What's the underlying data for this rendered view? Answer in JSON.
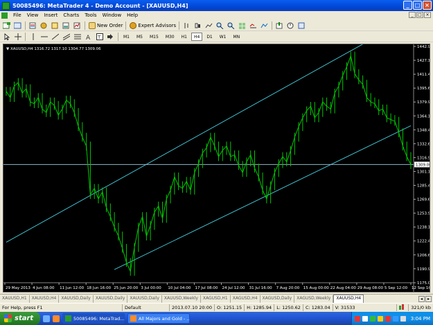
{
  "window": {
    "title": "50085496: MetaTrader 4 - Demo Account - [XAUUSD,H4]",
    "buttons": [
      "_",
      "□",
      "×"
    ]
  },
  "menu": {
    "items": [
      "File",
      "View",
      "Insert",
      "Charts",
      "Tools",
      "Window",
      "Help"
    ],
    "mdi_buttons": [
      "_",
      "□",
      "×"
    ]
  },
  "toolbar": {
    "new_order": "New Order",
    "expert_advisors": "Expert Advisors",
    "timeframes": [
      "M1",
      "M5",
      "M15",
      "M30",
      "H1",
      "H4",
      "D1",
      "W1",
      "MN"
    ],
    "active_timeframe": "H4"
  },
  "chart_data": {
    "type": "line",
    "symbol_header": "XAUUSD,H4  1316.72  1317.10  1304.77  1309.06",
    "current_price_label": "1309.06",
    "ylim": [
      1175.05,
      1442.9
    ],
    "y_ticks": [
      "1442.90",
      "1427.15",
      "1411.40",
      "1395.65",
      "1379.90",
      "1364.15",
      "1348.40",
      "1332.65",
      "1316.90",
      "1301.15",
      "1285.40",
      "1269.65",
      "1253.90",
      "1238.15",
      "1222.40",
      "1206.65",
      "1190.90",
      "1175.05"
    ],
    "x_ticks": [
      "29 May 2013",
      "4 Jun 08:00",
      "11 Jun 12:00",
      "18 Jun 16:00",
      "25 Jun 20:00",
      "3 Jul 00:00",
      "10 Jul 04:00",
      "17 Jul 08:00",
      "24 Jul 12:00",
      "31 Jul 16:00",
      "7 Aug 20:00",
      "15 Aug 00:00",
      "22 Aug 04:00",
      "29 Aug 08:00",
      "5 Sep 12:00",
      "12 Sep 16:00"
    ],
    "price_line": 1309.06,
    "series": [
      {
        "values": [
          1392,
          1385,
          1398,
          1402,
          1390,
          1395,
          1380,
          1378,
          1385,
          1372,
          1368,
          1380,
          1376,
          1365,
          1372,
          1382,
          1378,
          1368,
          1352,
          1340,
          1330,
          1275,
          1282,
          1270,
          1278,
          1260,
          1250,
          1238,
          1228,
          1214,
          1198,
          1188,
          1215,
          1238,
          1250,
          1228,
          1240,
          1255,
          1262,
          1248,
          1270,
          1280,
          1295,
          1285,
          1282,
          1290,
          1280,
          1300,
          1310,
          1322,
          1328,
          1340,
          1330,
          1318,
          1325,
          1330,
          1318,
          1320,
          1308,
          1300,
          1312,
          1320,
          1305,
          1295,
          1280,
          1270,
          1285,
          1300,
          1310,
          1318,
          1312,
          1325,
          1340,
          1352,
          1362,
          1370,
          1375,
          1362,
          1368,
          1380,
          1375,
          1372,
          1390,
          1398,
          1410,
          1420,
          1432,
          1412,
          1405,
          1400,
          1385,
          1380,
          1378,
          1370,
          1372,
          1362,
          1360,
          1358,
          1345,
          1330,
          1318,
          1309
        ]
      }
    ],
    "channel_lines": [
      {
        "x": [
          0,
          90
        ],
        "y": [
          1221,
          1448
        ]
      },
      {
        "x": [
          27,
          101
        ],
        "y": [
          1190,
          1353
        ]
      }
    ]
  },
  "sheet_tabs": [
    "XAUUSD,H1",
    "XAUUSD,H4",
    "XAUUSD,Daily",
    "XAUUSD,Daily",
    "XAUUSD,Daily",
    "XAUUSD,Weekly",
    "XAGUSD,H1",
    "XAGUSD,H4",
    "XAGUSD,Daily",
    "XAGUSD,Weekly",
    "XAUUSD,H4"
  ],
  "active_tab_index": 10,
  "status": {
    "help": "For Help, press F1",
    "profile": "Default",
    "datetime": "2013.07.10 20:00",
    "open": "O: 1251.15",
    "high": "H: 1285.94",
    "low": "L: 1250.62",
    "close": "C: 1283.04",
    "volume": "V: 31533",
    "traffic": "321/0 kb"
  },
  "taskbar": {
    "start": "start",
    "tasks": [
      "50085496: MetaTrad...",
      "All Majors and Gold - ..."
    ],
    "clock": "3:04 PM"
  },
  "colors": {
    "chart_bg": "#000000",
    "candle": "#00c800",
    "channel": "#40c0d0",
    "price_line": "#8fb8c8",
    "axis_text": "#ffffff"
  }
}
